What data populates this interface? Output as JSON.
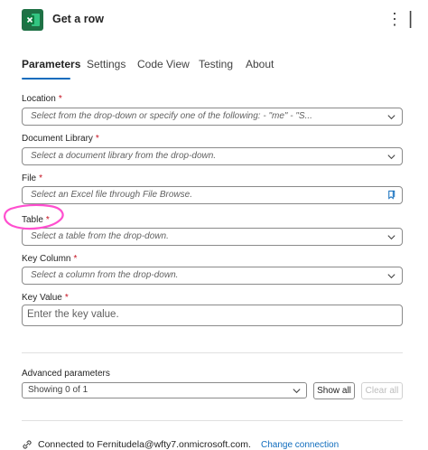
{
  "header": {
    "title": "Get a row"
  },
  "tabs": [
    {
      "label": "Parameters"
    },
    {
      "label": "Settings"
    },
    {
      "label": "Code View"
    },
    {
      "label": "Testing"
    },
    {
      "label": "About"
    }
  ],
  "fields": {
    "location": {
      "label": "Location",
      "required": "*",
      "placeholder": "Select from the drop-down or specify one of the following:      - \"me\"      - \"S..."
    },
    "library": {
      "label": "Document Library",
      "required": "*",
      "placeholder": "Select a document library from the drop-down."
    },
    "file": {
      "label": "File",
      "required": "*",
      "placeholder": "Select an Excel file through File Browse."
    },
    "table": {
      "label": "Table",
      "required": "*",
      "placeholder": "Select a table from the drop-down."
    },
    "key_column": {
      "label": "Key Column",
      "required": "*",
      "placeholder": "Select a column from the drop-down."
    },
    "key_value": {
      "label": "Key Value",
      "required": "*",
      "placeholder": "Enter the key value."
    }
  },
  "advanced": {
    "label": "Advanced parameters",
    "selected": "Showing 0 of 1",
    "show_all": "Show all",
    "clear_all": "Clear all"
  },
  "footer": {
    "connection_text": "Connected to Fernitudela@wfty7.onmicrosoft.com.",
    "change_link": "Change connection"
  },
  "colors": {
    "accent": "#0f6cbd",
    "required": "#c50f1f",
    "excel_green": "#1e7145",
    "annotation": "#ff4fcf"
  }
}
